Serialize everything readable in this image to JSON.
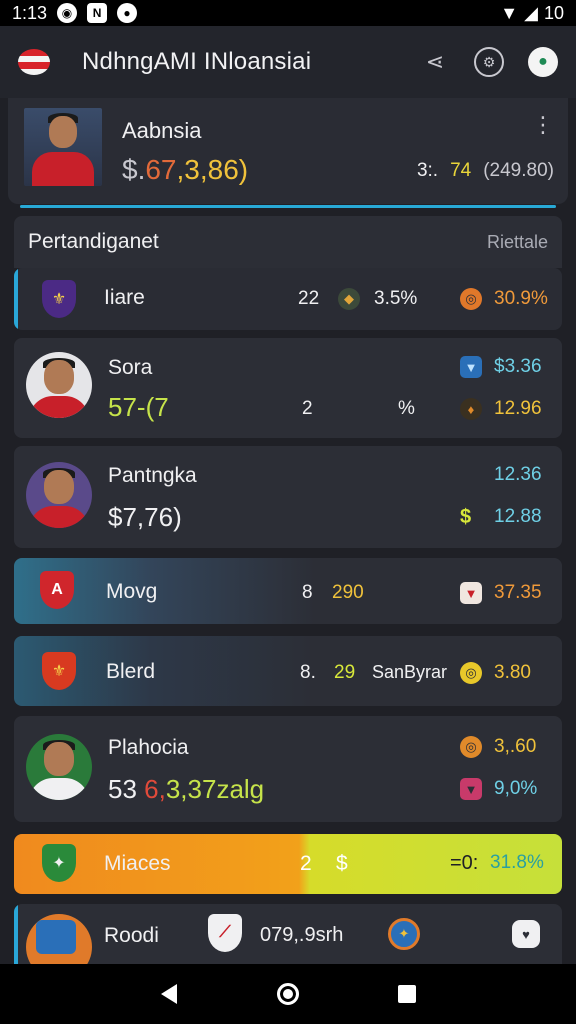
{
  "status": {
    "time": "1:13",
    "battery": "10"
  },
  "app": {
    "title": "NdhngAMI INloansiai",
    "share_icon": "share-icon",
    "settings_icon": "settings-icon",
    "flag_icon": "flag-icon"
  },
  "profile": {
    "name": "Aabnsia",
    "price_a": "$.",
    "price_b": "67",
    "price_c": ",3,86)",
    "stat1": "3:.",
    "stat2": "74",
    "stat3": "(249.80)"
  },
  "section": {
    "label": "Pertandiganet",
    "sub": "Riettale"
  },
  "rows": [
    {
      "name": "Iiare",
      "v1": "22",
      "v2": "3.5%",
      "v3": "30.9%"
    },
    {
      "name": "Sora",
      "price": "57-(7",
      "v1": "2",
      "v2": "%",
      "v3": "$3.36",
      "v4": "12.96"
    },
    {
      "name": "Pantngka",
      "price": "$7,76)",
      "v3": "12.36",
      "v4": "12.88"
    },
    {
      "name": "Movg",
      "v1": "8",
      "v2": "290",
      "v3": "37.35"
    },
    {
      "name": "Blerd",
      "v1": "8.",
      "v2": "29",
      "v2b": "SanByrar",
      "v3": "3.80"
    },
    {
      "name": "Plahocia",
      "price_a": "53",
      "price_b": "6,",
      "price_c": "3,37zalg",
      "v3": "3,.60",
      "v4": "9,0%"
    },
    {
      "name": "Miaces",
      "v1": "2",
      "v2": "$",
      "v3": "=0:",
      "v4": "31.8%"
    },
    {
      "name": "Roodi",
      "v1": "079,.9srh"
    }
  ]
}
